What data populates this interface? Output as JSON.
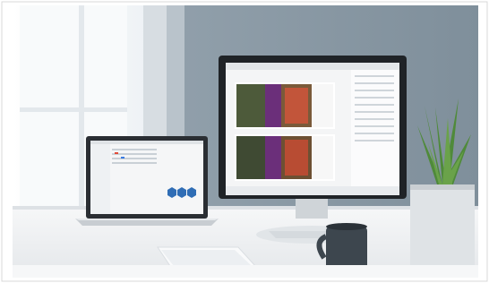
{
  "scene": {
    "subject": "desk-workspace",
    "devices": [
      "desktop-monitor",
      "laptop",
      "keyboard",
      "mug",
      "potted-plant"
    ]
  },
  "colors": {
    "wall_right": "#8a9aa6",
    "wall_left": "#e9eef2",
    "window": "#f4f7fa",
    "desk": "#f1f3f5",
    "monitor_bezel": "#1f2327",
    "mug": "#3d464e",
    "plant_pot": "#dfe3e6",
    "plant_leaf": "#4f8a3a",
    "brochure_purple": "#6b2f7a"
  }
}
